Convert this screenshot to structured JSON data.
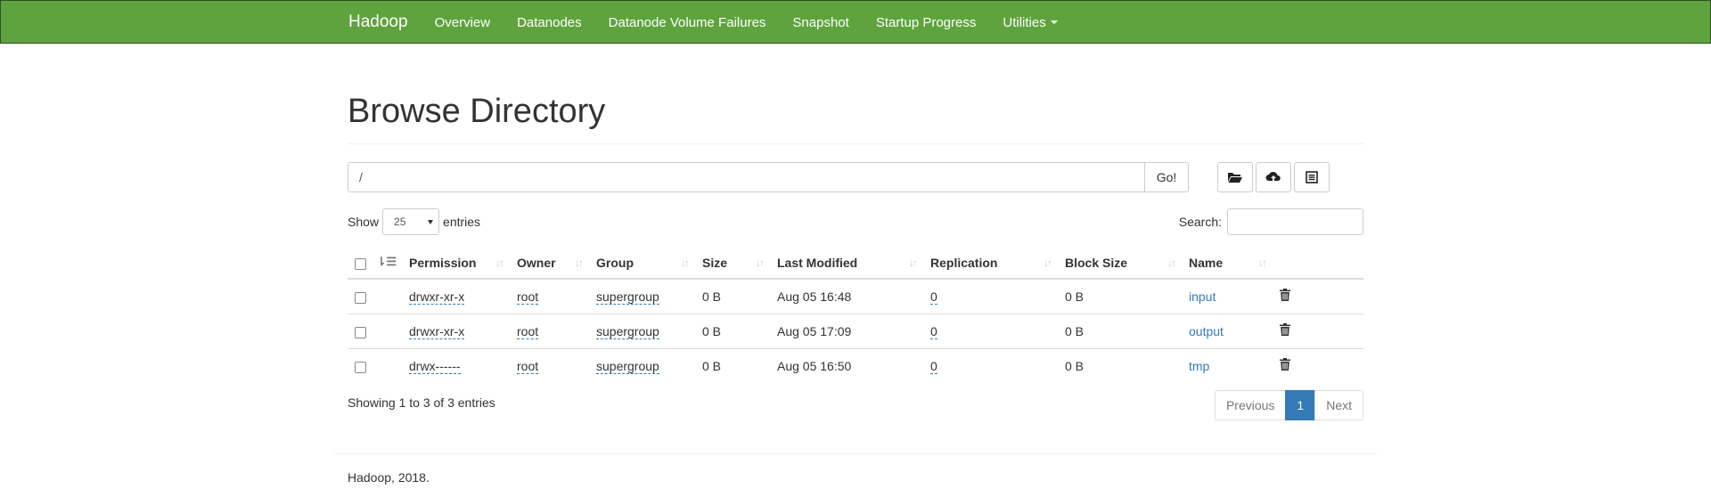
{
  "navbar": {
    "brand": "Hadoop",
    "items": [
      "Overview",
      "Datanodes",
      "Datanode Volume Failures",
      "Snapshot",
      "Startup Progress",
      "Utilities"
    ]
  },
  "page": {
    "title": "Browse Directory"
  },
  "path": {
    "value": "/",
    "go_label": "Go!"
  },
  "length": {
    "show_label": "Show",
    "selected": "25",
    "entries_label": "entries"
  },
  "search": {
    "label": "Search:"
  },
  "table": {
    "headers": [
      "Permission",
      "Owner",
      "Group",
      "Size",
      "Last Modified",
      "Replication",
      "Block Size",
      "Name"
    ],
    "rows": [
      [
        "drwxr-xr-x",
        "root",
        "supergroup",
        "0 B",
        "Aug 05 16:48",
        "0",
        "0 B",
        "input"
      ],
      [
        "drwxr-xr-x",
        "root",
        "supergroup",
        "0 B",
        "Aug 05 17:09",
        "0",
        "0 B",
        "output"
      ],
      [
        "drwx------",
        "root",
        "supergroup",
        "0 B",
        "Aug 05 16:50",
        "0",
        "0 B",
        "tmp"
      ]
    ]
  },
  "info": "Showing 1 to 3 of 3 entries",
  "pagination": {
    "previous": "Previous",
    "current": "1",
    "next": "Next"
  },
  "footer": "Hadoop, 2018.",
  "icons": [
    "folder-open-icon",
    "cloud-upload-icon",
    "list-alt-icon",
    "trash-icon",
    "sort-icon"
  ],
  "colors": {
    "navbar": "#5fa33e",
    "accent": "#337ab7"
  }
}
